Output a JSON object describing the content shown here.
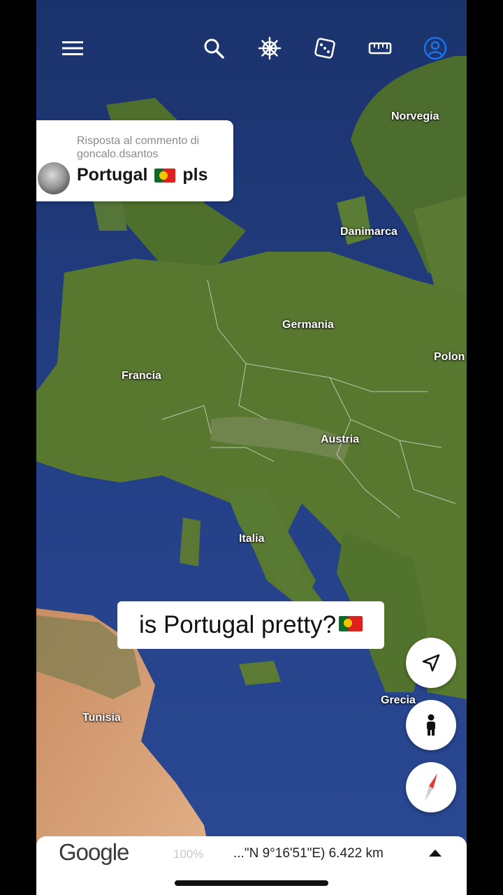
{
  "toolbar": {
    "menu_icon": "hamburger-menu-icon",
    "search_icon": "search-icon",
    "voyager_icon": "ship-wheel-icon",
    "feeling_lucky_icon": "dice-icon",
    "measure_icon": "ruler-icon",
    "account_icon": "account-icon"
  },
  "comment": {
    "reply_line": "Risposta al commento di goncalo.dsantos",
    "text_before": "Portugal",
    "text_after": "pls",
    "flag": "portugal-flag"
  },
  "map_labels": {
    "norvegia": "Norvegia",
    "danimarca": "Danimarca",
    "germania": "Germania",
    "polonia": "Polon",
    "francia": "Francia",
    "austria": "Austria",
    "italia": "Italia",
    "grecia": "Grecia",
    "tunisia": "Tunisia"
  },
  "caption": {
    "text": "is Portugal pretty?",
    "flag": "portugal-flag"
  },
  "controls": {
    "locate_icon": "navigation-arrow-icon",
    "street_view_icon": "pegman-icon",
    "compass_icon": "compass-icon"
  },
  "footer": {
    "logo": "Google",
    "zoom": "100%",
    "coordinates": "...\"N 9°16'51\"E) 6.422 km",
    "expand_icon": "caret-up-icon"
  },
  "colors": {
    "sea": "#1f3f86",
    "land": "#55762f",
    "desert": "#d7a478",
    "accent_blue": "#1a73e8",
    "compass_red": "#e53935"
  }
}
